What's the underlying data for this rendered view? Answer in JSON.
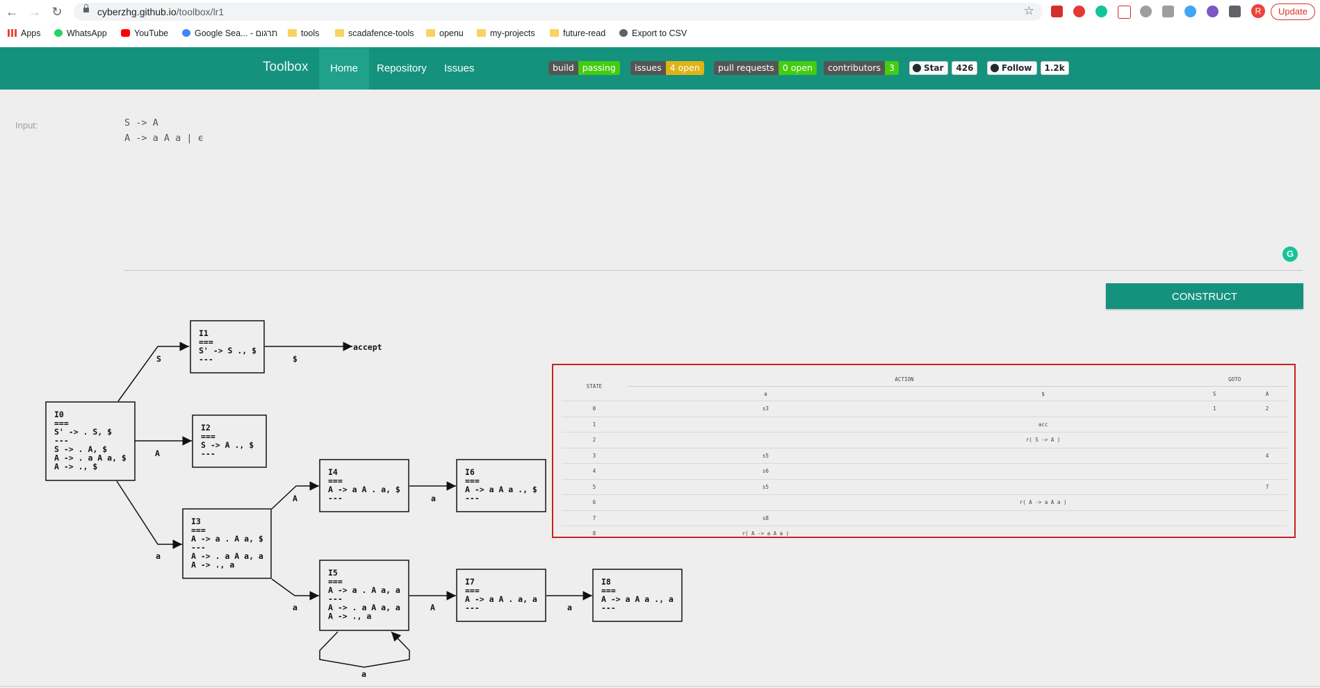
{
  "browser": {
    "url_host": "cyberzhg.github.io",
    "url_path": "/toolbox/lr1",
    "avatar_letter": "R",
    "update_label": "Update",
    "bookmarks": [
      {
        "label": "Apps",
        "icon": "apps-grid-icon"
      },
      {
        "label": "WhatsApp",
        "icon": "whatsapp-icon"
      },
      {
        "label": "YouTube",
        "icon": "youtube-icon"
      },
      {
        "label": "Google Sea... - תרגום",
        "icon": "google-icon"
      },
      {
        "label": "tools",
        "icon": "folder-icon"
      },
      {
        "label": "scadafence-tools",
        "icon": "folder-icon"
      },
      {
        "label": "openu",
        "icon": "folder-icon"
      },
      {
        "label": "my-projects",
        "icon": "folder-icon"
      },
      {
        "label": "future-read",
        "icon": "folder-icon"
      },
      {
        "label": "Export to CSV",
        "icon": "globe-icon"
      }
    ]
  },
  "header": {
    "brand": "Toolbox",
    "nav": [
      {
        "label": "Home",
        "active": true
      },
      {
        "label": "Repository",
        "active": false
      },
      {
        "label": "Issues",
        "active": false
      }
    ],
    "badges": [
      {
        "left": "build",
        "right": "passing",
        "color": "#4c1"
      },
      {
        "left": "issues",
        "right": "4 open",
        "color": "#dfb317"
      },
      {
        "left": "pull requests",
        "right": "0 open",
        "color": "#4c1"
      },
      {
        "left": "contributors",
        "right": "3",
        "color": "#4c1"
      }
    ],
    "github": [
      {
        "label": "Star",
        "count": "426"
      },
      {
        "label": "Follow",
        "count": "1.2k"
      }
    ]
  },
  "main": {
    "input_label": "Input:",
    "grammar": "S -> A\nA -> a A a | ϵ",
    "construct_label": "CONSTRUCT"
  },
  "automaton": {
    "states": [
      {
        "id": "I0",
        "lines": [
          "I0",
          "===",
          "S' -> . S, $",
          "---",
          "S -> . A, $",
          "A -> . a A a, $",
          "A -> ., $"
        ]
      },
      {
        "id": "I1",
        "lines": [
          "I1",
          "===",
          "S' -> S ., $",
          "---"
        ]
      },
      {
        "id": "I2",
        "lines": [
          "I2",
          "===",
          "S -> A ., $",
          "---"
        ]
      },
      {
        "id": "I3",
        "lines": [
          "I3",
          "===",
          "A -> a . A a, $",
          "---",
          "A -> . a A a, a",
          "A -> ., a"
        ]
      },
      {
        "id": "I4",
        "lines": [
          "I4",
          "===",
          "A -> a A . a, $",
          "---"
        ]
      },
      {
        "id": "I5",
        "lines": [
          "I5",
          "===",
          "A -> a . A a, a",
          "---",
          "A -> . a A a, a",
          "A -> ., a"
        ]
      },
      {
        "id": "I6",
        "lines": [
          "I6",
          "===",
          "A -> a A a ., $",
          "---"
        ]
      },
      {
        "id": "I7",
        "lines": [
          "I7",
          "===",
          "A -> a A . a, a",
          "---"
        ]
      },
      {
        "id": "I8",
        "lines": [
          "I8",
          "===",
          "A -> a A a ., a",
          "---"
        ]
      }
    ],
    "accept_label": "accept",
    "edges": [
      {
        "from": "I0",
        "to": "I1",
        "label": "S"
      },
      {
        "from": "I1",
        "to": "accept",
        "label": "$"
      },
      {
        "from": "I0",
        "to": "I2",
        "label": "A"
      },
      {
        "from": "I0",
        "to": "I3",
        "label": "a"
      },
      {
        "from": "I3",
        "to": "I4",
        "label": "A"
      },
      {
        "from": "I4",
        "to": "I6",
        "label": "a"
      },
      {
        "from": "I3",
        "to": "I5",
        "label": "a"
      },
      {
        "from": "I5",
        "to": "I7",
        "label": "A"
      },
      {
        "from": "I7",
        "to": "I8",
        "label": "a"
      },
      {
        "from": "I5",
        "to": "I5",
        "label": "a"
      }
    ]
  },
  "parse_table": {
    "state_header": "STATE",
    "action_header": "ACTION",
    "goto_header": "GOTO",
    "action_cols": [
      "a",
      "$"
    ],
    "goto_cols": [
      "S",
      "A"
    ],
    "rows": [
      {
        "state": "0",
        "a": "s3",
        "$": "",
        "S": "1",
        "A": "2"
      },
      {
        "state": "1",
        "a": "",
        "$": "acc",
        "S": "",
        "A": ""
      },
      {
        "state": "2",
        "a": "",
        "$": "r( S -> A )",
        "S": "",
        "A": ""
      },
      {
        "state": "3",
        "a": "s5",
        "$": "",
        "S": "",
        "A": "4"
      },
      {
        "state": "4",
        "a": "s6",
        "$": "",
        "S": "",
        "A": ""
      },
      {
        "state": "5",
        "a": "s5",
        "$": "",
        "S": "",
        "A": "7"
      },
      {
        "state": "6",
        "a": "",
        "$": "r( A -> a A a )",
        "S": "",
        "A": ""
      },
      {
        "state": "7",
        "a": "s8",
        "$": "",
        "S": "",
        "A": ""
      },
      {
        "state": "8",
        "a": "r( A -> a A a )",
        "$": "",
        "S": "",
        "A": ""
      }
    ]
  }
}
